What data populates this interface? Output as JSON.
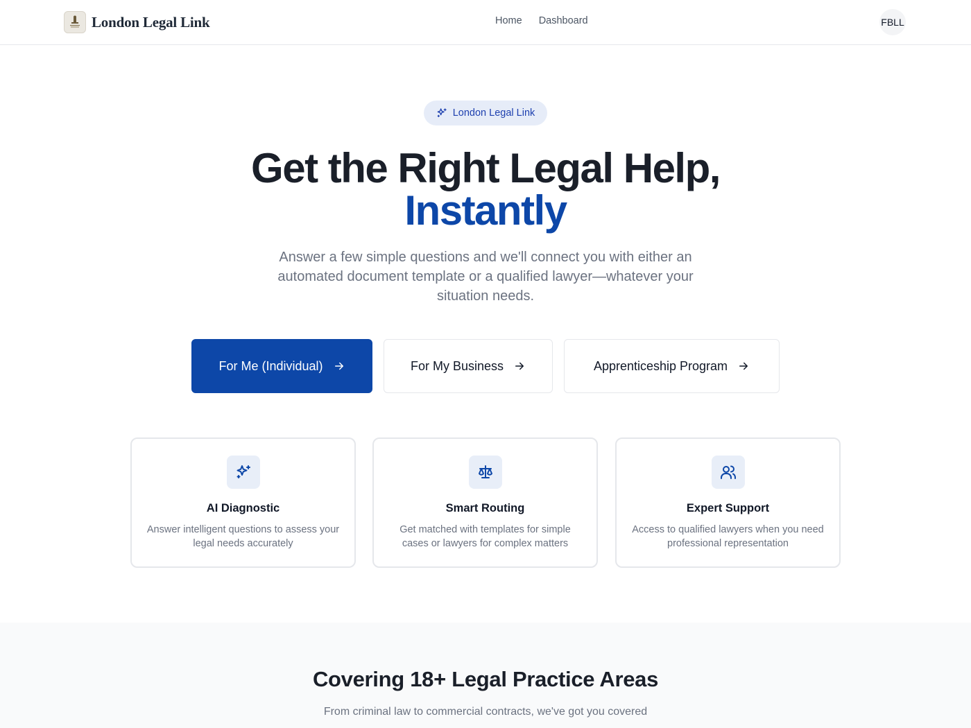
{
  "nav": {
    "brand": "London Legal Link",
    "links": [
      "Home",
      "Dashboard"
    ],
    "avatar": "FBLL"
  },
  "hero": {
    "badge": "London Legal Link",
    "title_line1": "Get the Right Legal Help,",
    "title_line2": "Instantly",
    "subtitle": "Answer a few simple questions and we'll connect you with either an automated document template or a qualified lawyer—whatever your situation needs.",
    "buttons": [
      "For Me (Individual)",
      "For My Business",
      "Apprenticeship Program"
    ]
  },
  "features": [
    {
      "icon": "sparkles-icon",
      "title": "AI Diagnostic",
      "desc": "Answer intelligent questions to assess your legal needs accurately"
    },
    {
      "icon": "scale-icon",
      "title": "Smart Routing",
      "desc": "Get matched with templates for simple cases or lawyers for complex matters"
    },
    {
      "icon": "users-icon",
      "title": "Expert Support",
      "desc": "Access to qualified lawyers when you need professional representation"
    }
  ],
  "areas": {
    "title": "Covering 18+ Legal Practice Areas",
    "subtitle": "From criminal law to commercial contracts, we've got you covered"
  },
  "colors": {
    "primary": "#0d47a8",
    "badge_bg": "#e6ecf8",
    "text_dark": "#1a1f29",
    "text_muted": "#6b7280",
    "border": "#e5e7eb"
  }
}
